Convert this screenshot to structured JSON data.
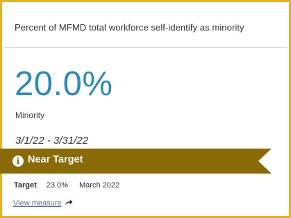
{
  "card": {
    "title": "Percent of MFMD total workforce self-identify as minority",
    "value": "20.0%",
    "value_label": "Minority",
    "date_range": "3/1/22 - 3/31/22",
    "status": {
      "icon": "info-icon",
      "icon_glyph": "i",
      "text": "Near Target",
      "color": "#8a6a06"
    },
    "target": {
      "label": "Target",
      "value": "23.0%",
      "period": "March 2022"
    },
    "link": {
      "text": "View measure",
      "icon": "share-arrow-icon"
    },
    "colors": {
      "border": "#e2b22a",
      "value": "#2e8bb6"
    }
  }
}
